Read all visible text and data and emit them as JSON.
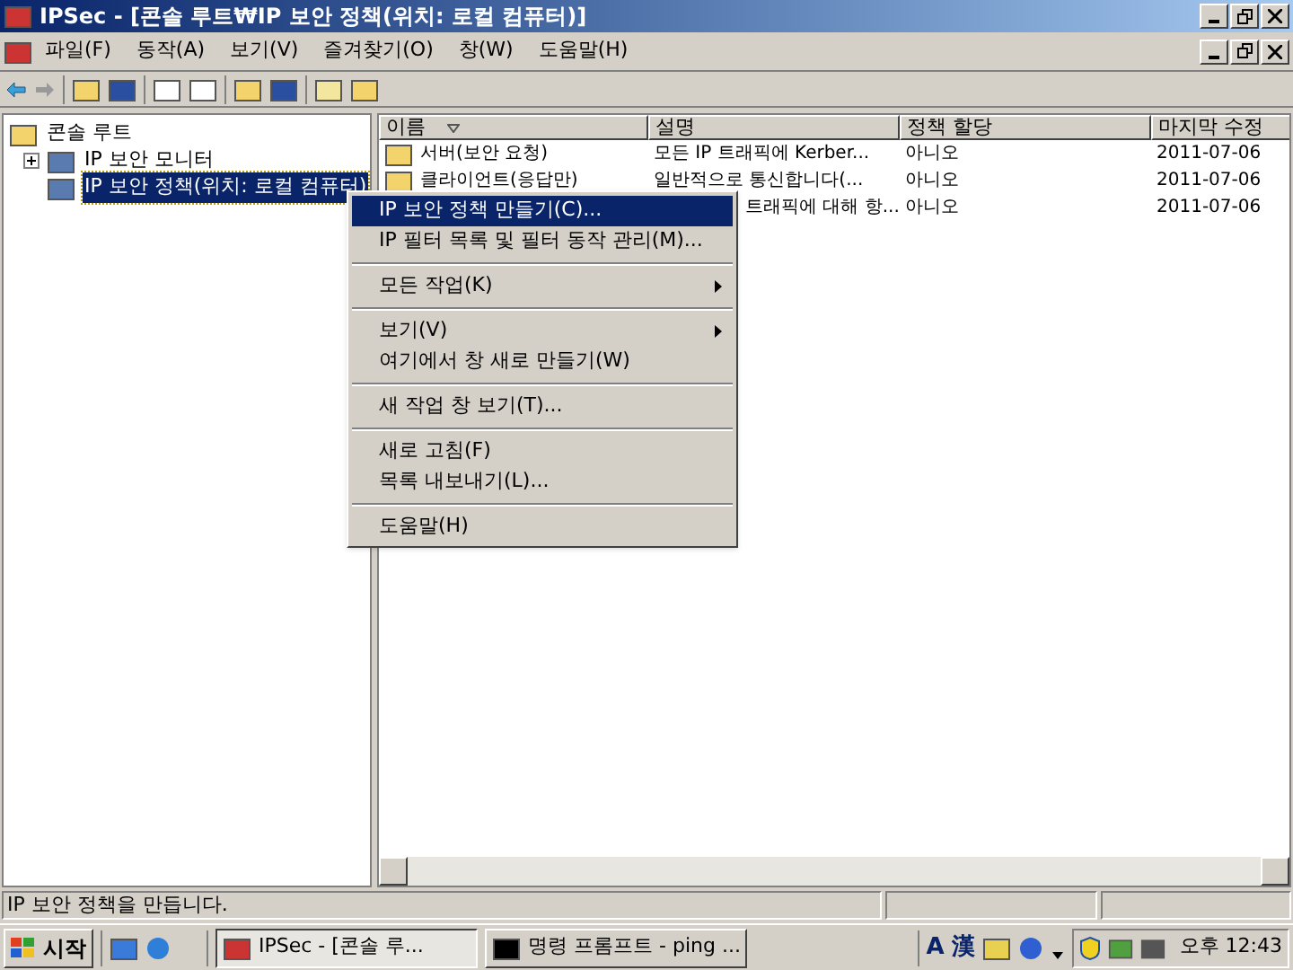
{
  "window": {
    "title": "IPSec - [콘솔 루트₩IP 보안 정책(위치: 로컬 컴퓨터)]"
  },
  "menu_bar": [
    "파일(F)",
    "동작(A)",
    "보기(V)",
    "즐겨찾기(O)",
    "창(W)",
    "도움말(H)"
  ],
  "tree": [
    {
      "label": "콘솔 루트",
      "selected": false,
      "children": [
        {
          "label": "IP 보안 모니터",
          "selected": false,
          "expanded": false
        },
        {
          "label": "IP 보안 정책(위치: 로컬 컴퓨터)",
          "selected": true
        }
      ]
    }
  ],
  "table": {
    "columns": [
      "이름",
      "설명",
      "정책 할당",
      "마지막 수정"
    ],
    "rows": [
      {
        "cells": [
          "서버(보안 요청)",
          "모든 IP 트래픽에 Kerber...",
          "아니오",
          "2011-07-06"
        ]
      },
      {
        "cells": [
          "클라이언트(응답만)",
          "일반적으로 통신합니다(...",
          "아니오",
          "2011-07-06"
        ]
      },
      {
        "cells": [
          "",
          "트래픽에 대해 항...",
          "아니오",
          "2011-07-06"
        ]
      }
    ]
  },
  "context_menu": [
    {
      "kind": "item",
      "label": "IP 보안 정책 만들기(C)...",
      "selected": true
    },
    {
      "kind": "item",
      "label": "IP 필터 목록 및 필터 동작 관리(M)...",
      "selected": false
    },
    {
      "kind": "separator"
    },
    {
      "kind": "submenu",
      "label": "모든 작업(K)",
      "selected": false
    },
    {
      "kind": "separator"
    },
    {
      "kind": "submenu",
      "label": "보기(V)",
      "selected": false
    },
    {
      "kind": "item",
      "label": "여기에서 창 새로 만들기(W)",
      "selected": false
    },
    {
      "kind": "separator"
    },
    {
      "kind": "item",
      "label": "새 작업 창 보기(T)...",
      "selected": false
    },
    {
      "kind": "separator"
    },
    {
      "kind": "item",
      "label": "새로 고침(F)",
      "selected": false
    },
    {
      "kind": "item",
      "label": "목록 내보내기(L)...",
      "selected": false
    },
    {
      "kind": "separator"
    },
    {
      "kind": "item",
      "label": "도움말(H)",
      "selected": false
    }
  ],
  "status_bar": "IP 보안 정책을 만듭니다.",
  "taskbar": {
    "start": "시작",
    "tasks": [
      {
        "label": "IPSec - [콘솔 루...",
        "selected": true
      },
      {
        "label": "명령 프롬프트 - ping ...",
        "selected": false
      }
    ],
    "ime": [
      "A",
      "漢"
    ],
    "clock": "오후 12:43"
  }
}
